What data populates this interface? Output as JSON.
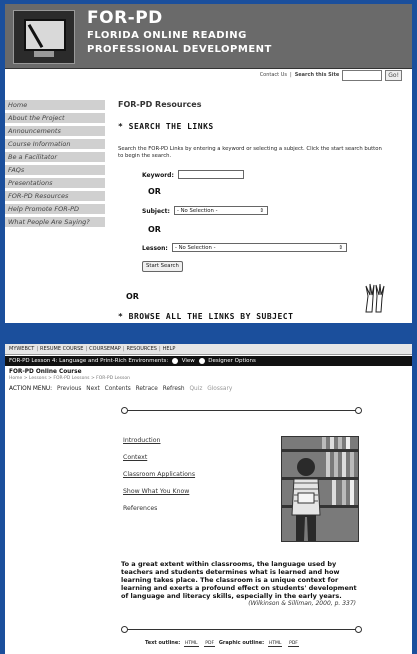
{
  "top": {
    "header": {
      "title": "FOR-PD",
      "line2": "FLORIDA ONLINE READING",
      "line3": "PROFESSIONAL DEVELOPMENT"
    },
    "toplinks": {
      "contact": "Contact Us",
      "search_label": "Search this Site",
      "go": "Go!"
    },
    "nav": [
      "Home",
      "About the Project",
      "Announcements",
      "Course Information",
      "Be a Facilitator",
      "FAQs",
      "Presentations",
      "FOR-PD Resources",
      "Help Promote FOR-PD",
      "What People Are Saying?"
    ],
    "main": {
      "title": "FOR-PD Resources",
      "search_heading": "* SEARCH THE LINKS",
      "search_desc": "Search the FOR-PD Links by entering a keyword or selecting a subject. Click the start search button to begin the search.",
      "keyword_label": "Keyword:",
      "keyword_value": "",
      "or1": "OR",
      "subject_label": "Subject:",
      "subject_value": "- No Selection -",
      "or2": "OR",
      "lesson_label": "Lesson:",
      "lesson_value": "- No Selection -",
      "start_button": "Start Search",
      "or3": "OR",
      "browse_heading": "* BROWSE ALL THE LINKS BY SUBJECT"
    }
  },
  "bottom": {
    "nav": [
      "MYWEBCT",
      "RESUME COURSE",
      "COURSEMAP",
      "RESOURCES",
      "HELP"
    ],
    "lesson_bar": {
      "title": "FOR-PD Lesson 4: Language and Print-Rich Environments:",
      "view": "View",
      "designer": "Designer Options"
    },
    "course_title": "FOR-PD Online Course",
    "breadcrumb": "Home > Lessons > FOR-PD Lessons > FOR-PD Lesson",
    "action_menu": {
      "label": "ACTION MENU:",
      "items": [
        "Previous",
        "Next",
        "Contents",
        "Retrace",
        "Refresh",
        "Quiz",
        "Glossary"
      ]
    },
    "toc": [
      "Introduction",
      "Context",
      "Classroom Applications",
      "Show What You Know",
      "References"
    ],
    "quote": "To a great extent within classrooms, the language used by teachers and students determines what is learned and how learning takes place. The classroom is a unique context for learning and exerts a profound effect on students' development of language and literacy skills, especially in the early years.",
    "citation": "(Wilkinson & Silliman, 2000, p. 337)",
    "outline": {
      "text_label": "Text outline:",
      "graphic_label": "Graphic outline:",
      "html": "HTML",
      "pdf": "PDF"
    }
  }
}
